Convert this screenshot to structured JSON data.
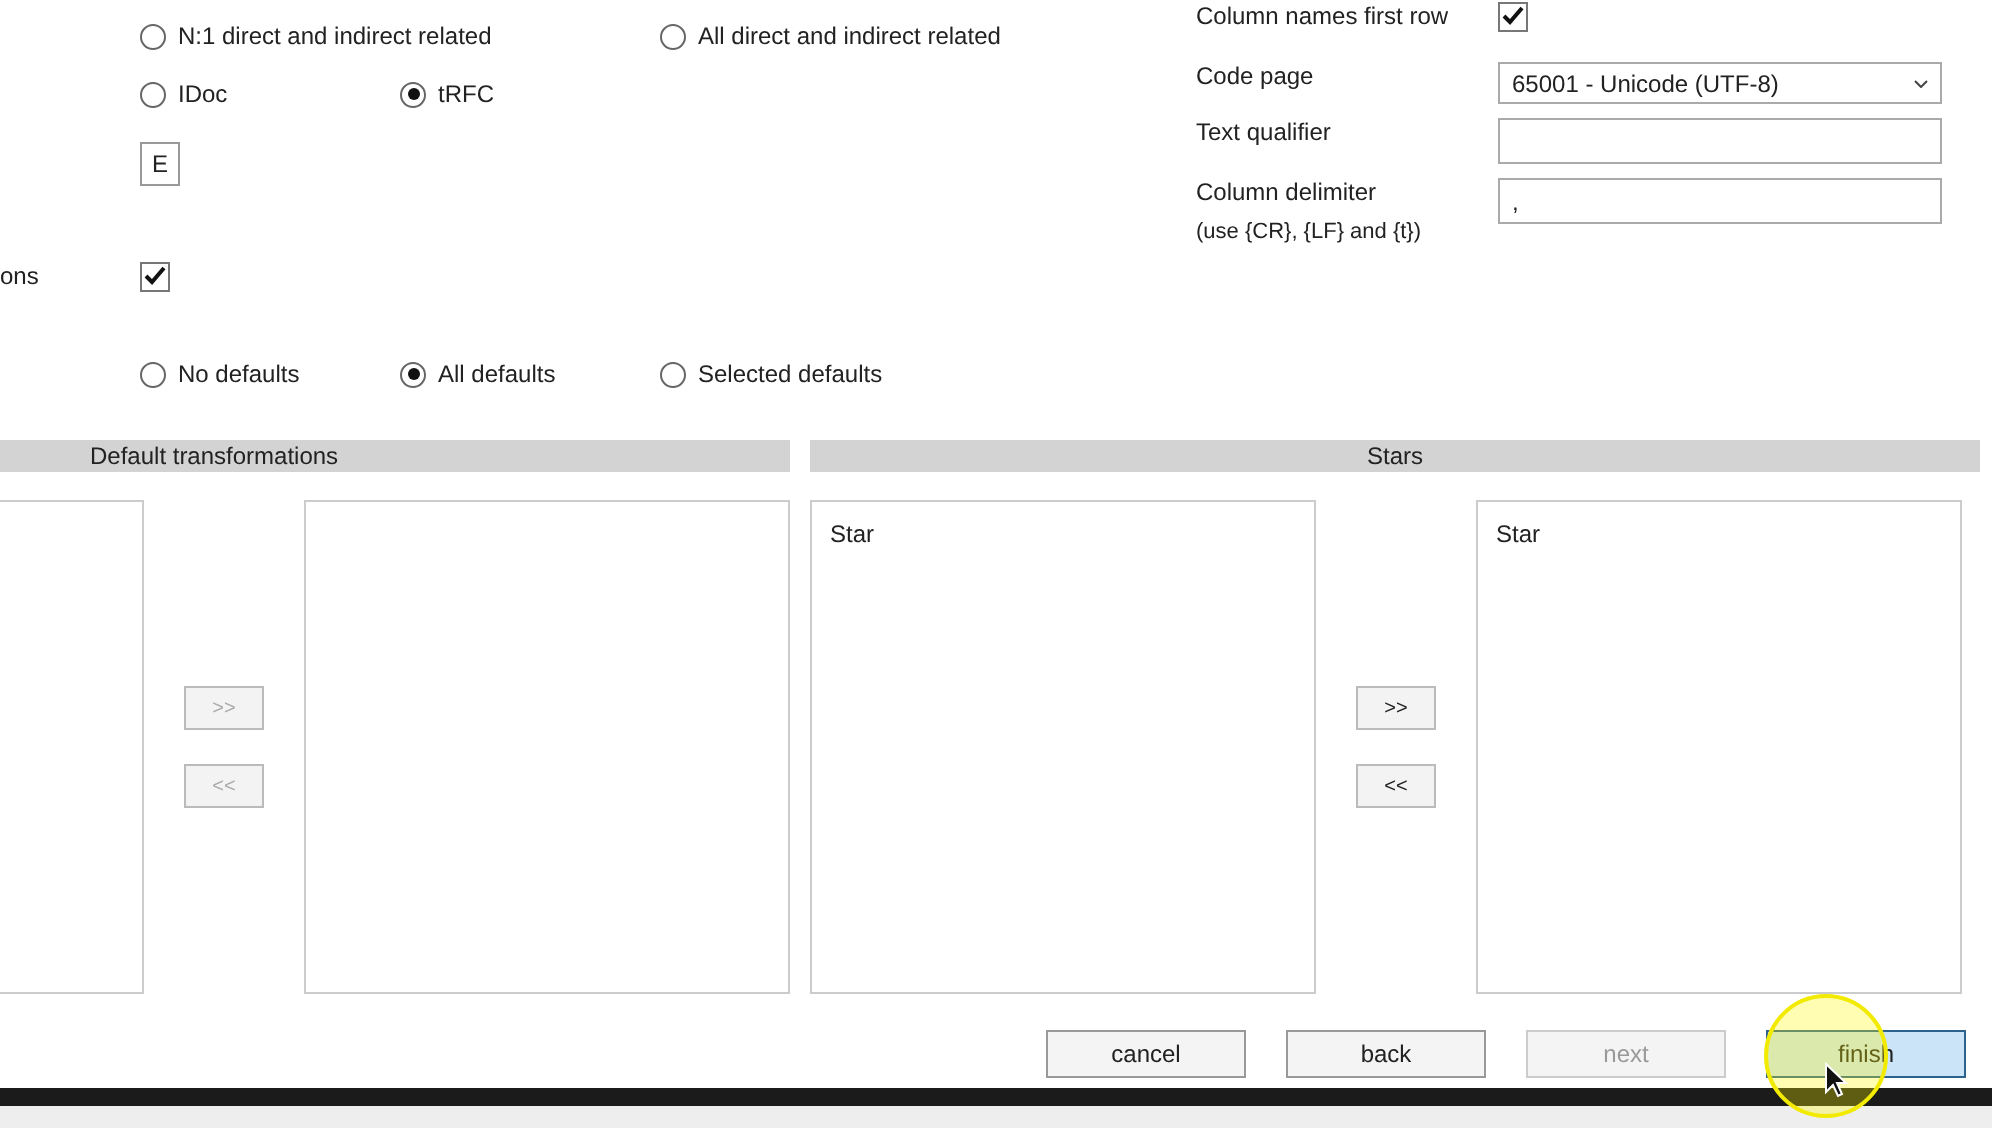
{
  "left_form": {
    "relation_options": [
      {
        "label": "N:1 direct and indirect related",
        "selected": false
      },
      {
        "label": "All direct and indirect related",
        "selected": false
      }
    ],
    "transfer_options": [
      {
        "label": "IDoc",
        "selected": false
      },
      {
        "label": "tRFC",
        "selected": true
      }
    ],
    "code_field": {
      "value": "E"
    },
    "option_row": {
      "label": "ons",
      "checked": true
    },
    "defaults_options": [
      {
        "label": "No defaults",
        "selected": false
      },
      {
        "label": "All defaults",
        "selected": true
      },
      {
        "label": "Selected defaults",
        "selected": false
      }
    ]
  },
  "right_form": {
    "column_names_first_row": {
      "label": "Column names first row",
      "checked": true
    },
    "code_page": {
      "label": "Code page",
      "value": "65001 - Unicode (UTF-8)"
    },
    "text_qualifier": {
      "label": "Text qualifier"
    },
    "column_delimiter": {
      "label": "Column delimiter",
      "hint": "(use {CR}, {LF} and {t})",
      "value": ","
    }
  },
  "panels": [
    {
      "title": "Default transformations",
      "add_button": {
        "label": ">>",
        "disabled": true
      },
      "remove_button": {
        "label": "<<",
        "disabled": true
      }
    },
    {
      "title": "Stars",
      "source_items": [
        "Star"
      ],
      "target_items": [
        "Star"
      ],
      "add_button": {
        "label": ">>",
        "disabled": false
      },
      "remove_button": {
        "label": "<<",
        "disabled": false
      }
    }
  ],
  "buttons": [
    {
      "label": "cancel",
      "disabled": false,
      "focused": false
    },
    {
      "label": "back",
      "disabled": false,
      "focused": false
    },
    {
      "label": "next",
      "disabled": true,
      "focused": false
    },
    {
      "label": "finish",
      "disabled": false,
      "focused": true
    }
  ]
}
